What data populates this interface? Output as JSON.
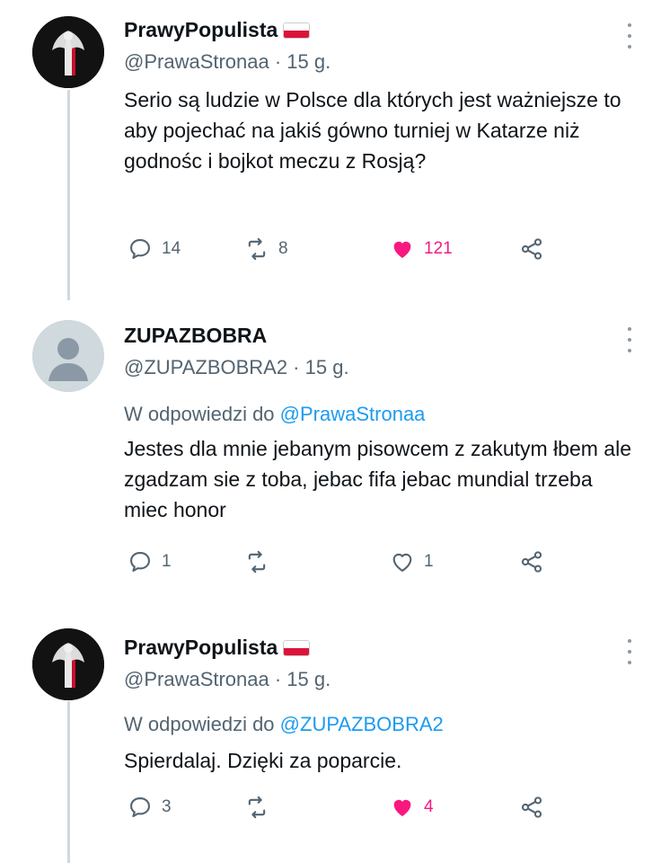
{
  "tweets": [
    {
      "name": "PrawyPopulista",
      "handle_time": "@PrawaStronaa · 15 g.",
      "reply_to_prefix": "",
      "reply_to_user": "",
      "text": "Serio są ludzie w Polsce dla których jest ważniejsze to aby pojechać na jakiś gówno turniej w Katarze niż godnośc i bojkot meczu z Rosją?",
      "replies": "14",
      "retweets": "8",
      "likes": "121",
      "liked": true
    },
    {
      "name": "ZUPAZBOBRA",
      "handle_time": "@ZUPAZBOBRA2 · 15 g.",
      "reply_to_prefix": "W odpowiedzi do",
      "reply_to_user": "@PrawaStronaa",
      "text": "Jestes dla mnie jebanym pisowcem z zakutym łbem ale zgadzam sie z toba, jebac fifa jebac mundial trzeba miec honor",
      "replies": "1",
      "retweets": "",
      "likes": "1",
      "liked": false
    },
    {
      "name": "PrawyPopulista",
      "handle_time": "@PrawaStronaa · 15 g.",
      "reply_to_prefix": "W odpowiedzi do",
      "reply_to_user": "@ZUPAZBOBRA2",
      "text": "Spierdalaj. Dzięki za poparcie.",
      "replies": "3",
      "retweets": "",
      "likes": "4",
      "liked": true
    }
  ],
  "icons": {
    "reply": "speech-bubble-icon",
    "retweet": "retweet-arrows-icon",
    "like": "heart-icon",
    "share": "share-nodes-icon",
    "more": "vertical-ellipsis-icon"
  },
  "colors": {
    "like_active": "#f91880",
    "mention": "#1d9bf0",
    "secondary_text": "#536471",
    "thread_line": "#cfd9de"
  }
}
